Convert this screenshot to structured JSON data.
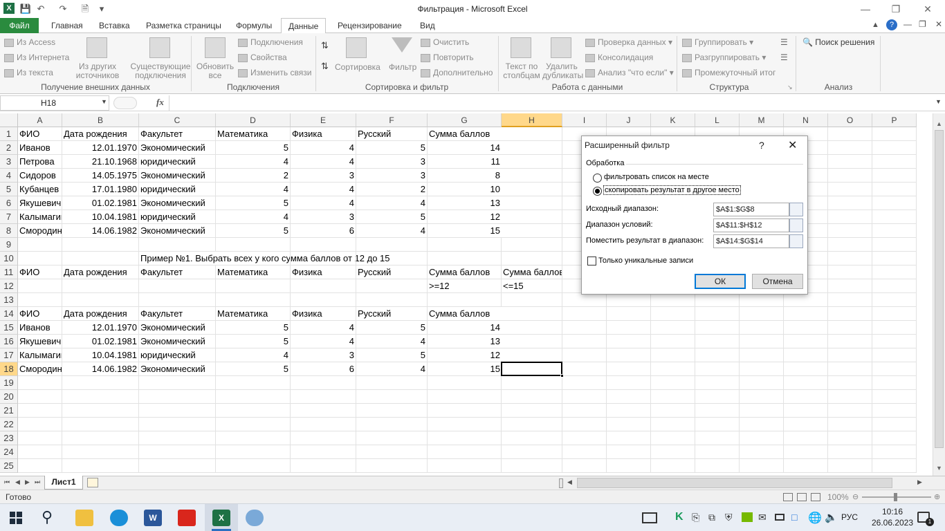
{
  "window": {
    "title": "Фильтрация  -  Microsoft Excel"
  },
  "ribbon_tabs": [
    "Файл",
    "Главная",
    "Вставка",
    "Разметка страницы",
    "Формулы",
    "Данные",
    "Рецензирование",
    "Вид"
  ],
  "ribbon": {
    "external": {
      "access": "Из Access",
      "web": "Из Интернета",
      "text": "Из текста",
      "other": "Из других источников",
      "existing": "Существующие подключения",
      "label": "Получение внешних данных"
    },
    "connections": {
      "refresh": "Обновить все",
      "conn": "Подключения",
      "props": "Свойства",
      "edit": "Изменить связи",
      "label": "Подключения"
    },
    "sortfilter": {
      "sort": "Сортировка",
      "filter": "Фильтр",
      "clear": "Очистить",
      "reapply": "Повторить",
      "advanced": "Дополнительно",
      "label": "Сортировка и фильтр"
    },
    "datatools": {
      "t2c": "Текст по столбцам",
      "dup": "Удалить дубликаты",
      "valid": "Проверка данных",
      "consol": "Консолидация",
      "whatif": "Анализ \"что если\"",
      "label": "Работа с данными"
    },
    "outline": {
      "group": "Группировать",
      "ungroup": "Разгруппировать",
      "subtotal": "Промежуточный итог",
      "label": "Структура"
    },
    "analysis": {
      "solver": "Поиск решения",
      "label": "Анализ"
    }
  },
  "formula_bar": {
    "name_box": "H18",
    "fx": "fx",
    "formula": ""
  },
  "columns": [
    "A",
    "B",
    "C",
    "D",
    "E",
    "F",
    "G",
    "H",
    "I",
    "J",
    "K",
    "L",
    "M",
    "N",
    "O",
    "P"
  ],
  "rows": [
    [
      "ФИО",
      "Дата рождения",
      "Факультет",
      "Математика",
      "Физика",
      "Русский",
      "Сумма баллов",
      ""
    ],
    [
      "Иванов",
      "12.01.1970",
      "Экономический",
      "5",
      "4",
      "5",
      "14",
      ""
    ],
    [
      "Петрова",
      "21.10.1968",
      "юридический",
      "4",
      "4",
      "3",
      "11",
      ""
    ],
    [
      "Сидоров",
      "14.05.1975",
      "Экономический",
      "2",
      "3",
      "3",
      "8",
      ""
    ],
    [
      "Кубанцев",
      "17.01.1980",
      "юридический",
      "4",
      "4",
      "2",
      "10",
      ""
    ],
    [
      "Якушевич",
      "01.02.1981",
      "Экономический",
      "5",
      "4",
      "4",
      "13",
      ""
    ],
    [
      "Калымагин",
      "10.04.1981",
      "юридический",
      "4",
      "3",
      "5",
      "12",
      ""
    ],
    [
      "Смородин",
      "14.06.1982",
      "Экономический",
      "5",
      "6",
      "4",
      "15",
      ""
    ],
    [
      "",
      "",
      "",
      "",
      "",
      "",
      "",
      ""
    ],
    [
      "",
      "",
      "Пример №1. Выбрать всех у кого сумма баллов от 12 до 15",
      "",
      "",
      "",
      "",
      ""
    ],
    [
      "ФИО",
      "Дата рождения",
      "Факультет",
      "Математика",
      "Физика",
      "Русский",
      "Сумма баллов",
      "Сумма баллов"
    ],
    [
      "",
      "",
      "",
      "",
      "",
      "",
      ">=12",
      "<=15"
    ],
    [
      "",
      "",
      "",
      "",
      "",
      "",
      "",
      ""
    ],
    [
      "ФИО",
      "Дата рождения",
      "Факультет",
      "Математика",
      "Физика",
      "Русский",
      "Сумма баллов",
      ""
    ],
    [
      "Иванов",
      "12.01.1970",
      "Экономический",
      "5",
      "4",
      "5",
      "14",
      ""
    ],
    [
      "Якушевич",
      "01.02.1981",
      "Экономический",
      "5",
      "4",
      "4",
      "13",
      ""
    ],
    [
      "Калымагин",
      "10.04.1981",
      "юридический",
      "4",
      "3",
      "5",
      "12",
      ""
    ],
    [
      "Смородин",
      "14.06.1982",
      "Экономический",
      "5",
      "6",
      "4",
      "15",
      ""
    ],
    [
      "",
      "",
      "",
      "",
      "",
      "",
      "",
      ""
    ],
    [
      "",
      "",
      "",
      "",
      "",
      "",
      "",
      ""
    ],
    [
      "",
      "",
      "",
      "",
      "",
      "",
      "",
      ""
    ],
    [
      "",
      "",
      "",
      "",
      "",
      "",
      "",
      ""
    ],
    [
      "",
      "",
      "",
      "",
      "",
      "",
      "",
      ""
    ],
    [
      "",
      "",
      "",
      "",
      "",
      "",
      "",
      ""
    ],
    [
      "",
      "",
      "",
      "",
      "",
      "",
      "",
      ""
    ]
  ],
  "dialog": {
    "title": "Расширенный фильтр",
    "help": "?",
    "group": "Обработка",
    "opt1": "фильтровать список на месте",
    "opt2": "скопировать результат в другое место",
    "src_label": "Исходный диапазон:",
    "src_value": "$A$1:$G$8",
    "crit_label": "Диапазон условий:",
    "crit_value": "$A$11:$H$12",
    "dest_label": "Поместить результат в диапазон:",
    "dest_value": "$A$14:$G$14",
    "unique": "Только уникальные записи",
    "ok": "ОК",
    "cancel": "Отмена"
  },
  "sheet_tab": "Лист1",
  "status": {
    "ready": "Готово",
    "zoom": "100%"
  },
  "taskbar": {
    "lang": "РУС",
    "time": "10:16",
    "date": "26.06.2023"
  }
}
